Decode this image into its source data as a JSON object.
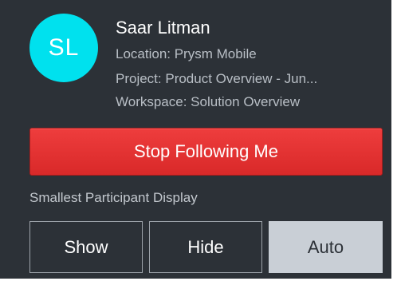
{
  "user": {
    "initials": "SL",
    "name": "Saar Litman",
    "location": "Location: Prysm Mobile",
    "project": "Project: Product Overview - Jun...",
    "workspace": "Workspace: Solution Overview"
  },
  "actions": {
    "stop_following_label": "Stop Following Me"
  },
  "display_setting": {
    "label": "Smallest Participant Display",
    "options": [
      "Show",
      "Hide",
      "Auto"
    ],
    "selected": "Auto"
  },
  "colors": {
    "panel_bg": "#2c3137",
    "avatar_bg": "#00e1ee",
    "stop_button": "#e43333",
    "selected_segment": "#c9cfd6"
  }
}
